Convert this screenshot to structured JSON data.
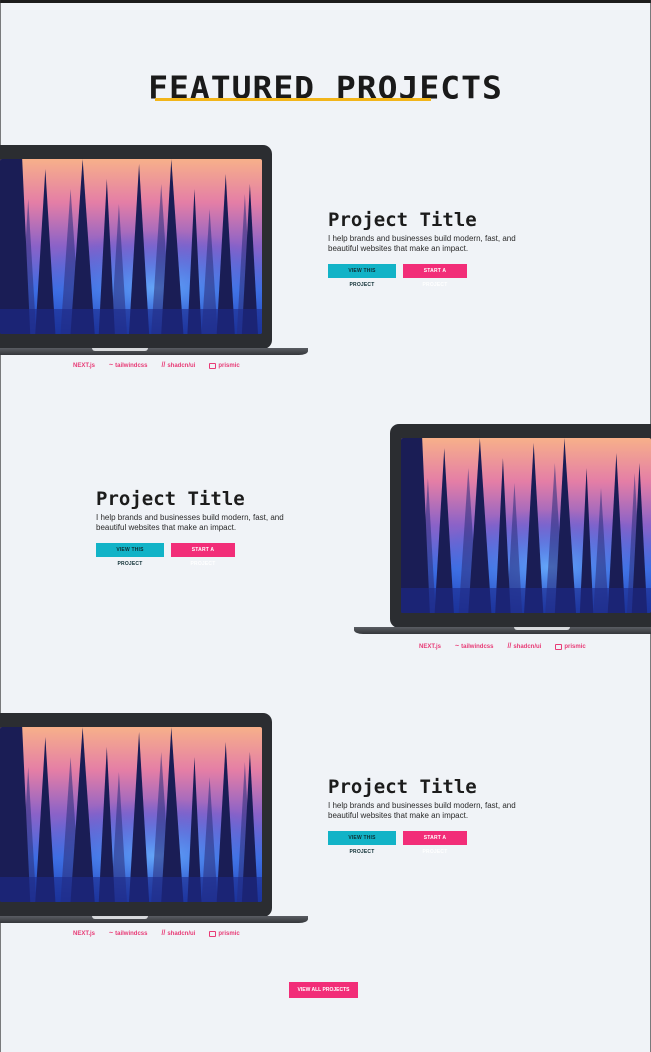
{
  "section": {
    "title": "FEATURED PROJECTS",
    "underline_color": "#f2b51a"
  },
  "projects": [
    {
      "title": "Project Title",
      "description": "I help brands and businesses build modern, fast, and beautiful websites that make an impact.",
      "view_label": "VIEW THIS PROJECT",
      "start_label": "START A PROJECT",
      "tech": [
        "NEXT.js",
        "tailwindcss",
        "shadcn/ui",
        "prismic"
      ]
    },
    {
      "title": "Project Title",
      "description": "I help brands and businesses build modern, fast, and beautiful websites that make an impact.",
      "view_label": "VIEW THIS PROJECT",
      "start_label": "START A PROJECT",
      "tech": [
        "NEXT.js",
        "tailwindcss",
        "shadcn/ui",
        "prismic"
      ]
    },
    {
      "title": "Project Title",
      "description": "I help brands and businesses build modern, fast, and beautiful websites that make an impact.",
      "view_label": "VIEW THIS PROJECT",
      "start_label": "START A PROJECT",
      "tech": [
        "NEXT.js",
        "tailwindcss",
        "shadcn/ui",
        "prismic"
      ]
    }
  ],
  "view_all_label": "VIEW ALL PROJECTS",
  "colors": {
    "background": "#f0f3f7",
    "accent_cyan": "#12b3c7",
    "accent_pink": "#f22d78",
    "title_text": "#1c1c1c"
  }
}
